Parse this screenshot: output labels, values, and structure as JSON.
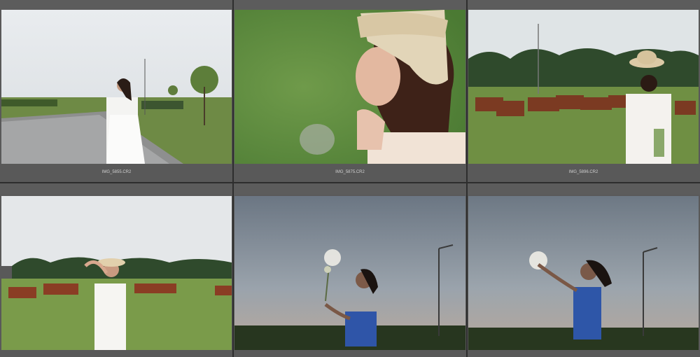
{
  "grid": {
    "cells": [
      {
        "filename": "IMG_5855.CR2",
        "scene": "girl-white-dress-road"
      },
      {
        "filename": "IMG_5875.CR2",
        "scene": "girl-hat-closeup"
      },
      {
        "filename": "IMG_5896.CR2",
        "scene": "girl-back-cows"
      },
      {
        "filename": "",
        "scene": "girl-hat-cows-field"
      },
      {
        "filename": "",
        "scene": "girl-blue-flowers-silhouette"
      },
      {
        "filename": "",
        "scene": "girl-blue-hand-raised"
      }
    ]
  },
  "colors": {
    "background": "#3a3a3a",
    "cell": "#595959",
    "caption_text": "#cfcfcf"
  }
}
